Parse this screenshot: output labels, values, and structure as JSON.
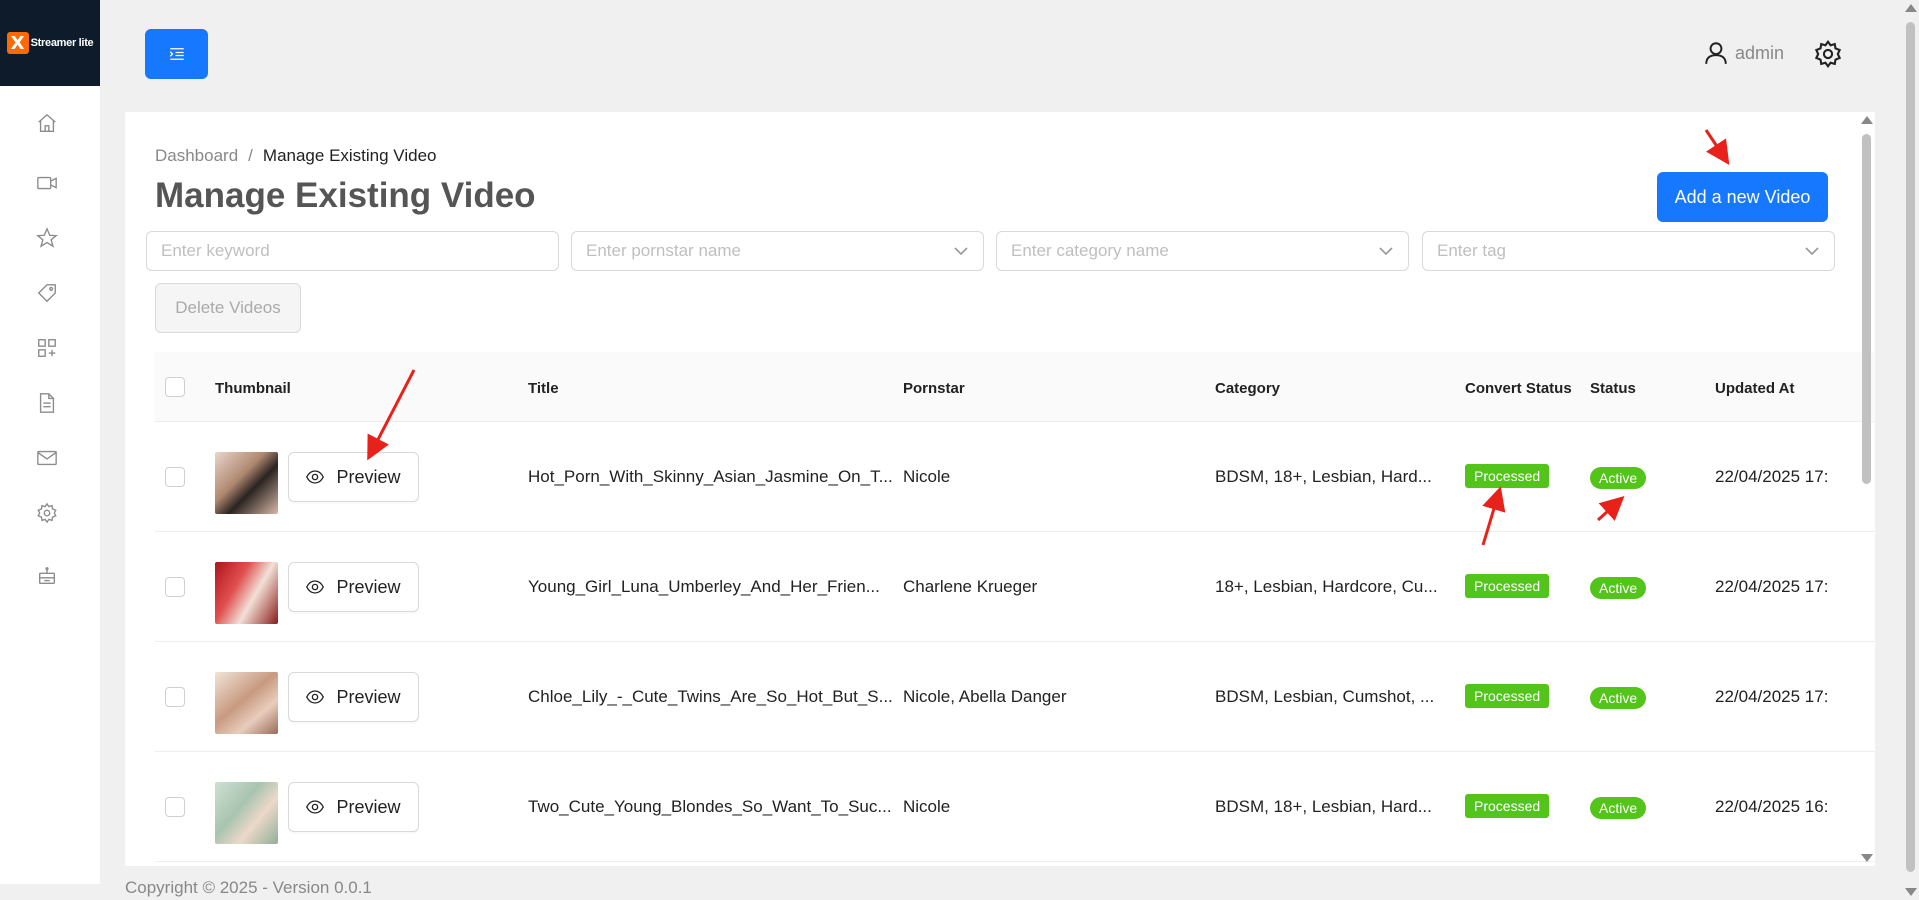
{
  "app": {
    "logo_letter": "X",
    "logo_text": "Streamer lite"
  },
  "sidebar": {
    "items": [
      {
        "icon": "home-icon"
      },
      {
        "icon": "video-icon"
      },
      {
        "icon": "star-icon"
      },
      {
        "icon": "tag-icon"
      },
      {
        "icon": "grid-icon"
      },
      {
        "icon": "document-icon"
      },
      {
        "icon": "mail-icon"
      },
      {
        "icon": "gear-icon"
      },
      {
        "icon": "robot-icon"
      }
    ]
  },
  "header": {
    "username": "admin"
  },
  "breadcrumb": {
    "root": "Dashboard",
    "separator": "/",
    "current": "Manage Existing Video"
  },
  "page_title": "Manage Existing Video",
  "add_button": "Add a new Video",
  "filters": {
    "keyword_placeholder": "Enter keyword",
    "pornstar_placeholder": "Enter pornstar name",
    "category_placeholder": "Enter category name",
    "tag_placeholder": "Enter tag"
  },
  "delete_button": "Delete Videos",
  "table": {
    "columns": {
      "thumbnail": "Thumbnail",
      "title": "Title",
      "pornstar": "Pornstar",
      "category": "Category",
      "convert_status": "Convert Status",
      "status": "Status",
      "updated_at": "Updated At"
    },
    "preview_label": "Preview",
    "rows": [
      {
        "title": "Hot_Porn_With_Skinny_Asian_Jasmine_On_T...",
        "pornstar": "Nicole",
        "category": "BDSM, 18+, Lesbian, Hard...",
        "convert_status": "Processed",
        "status": "Active",
        "updated_at": "22/04/2025 17:"
      },
      {
        "title": "Young_Girl_Luna_Umberley_And_Her_Frien...",
        "pornstar": "Charlene Krueger",
        "category": "18+, Lesbian, Hardcore, Cu...",
        "convert_status": "Processed",
        "status": "Active",
        "updated_at": "22/04/2025 17:"
      },
      {
        "title": "Chloe_Lily_-_Cute_Twins_Are_So_Hot_But_S...",
        "pornstar": "Nicole, Abella Danger",
        "category": "BDSM, Lesbian, Cumshot, ...",
        "convert_status": "Processed",
        "status": "Active",
        "updated_at": "22/04/2025 17:"
      },
      {
        "title": "Two_Cute_Young_Blondes_So_Want_To_Suc...",
        "pornstar": "Nicole",
        "category": "BDSM, 18+, Lesbian, Hard...",
        "convert_status": "Processed",
        "status": "Active",
        "updated_at": "22/04/2025 16:"
      }
    ]
  },
  "footer": "Copyright © 2025 - Version 0.0.1",
  "colors": {
    "primary": "#1677ff",
    "success": "#52c41a",
    "logo_bg": "#0d1b2a",
    "logo_accent": "#ff6a00",
    "annotation": "#e8211a"
  }
}
